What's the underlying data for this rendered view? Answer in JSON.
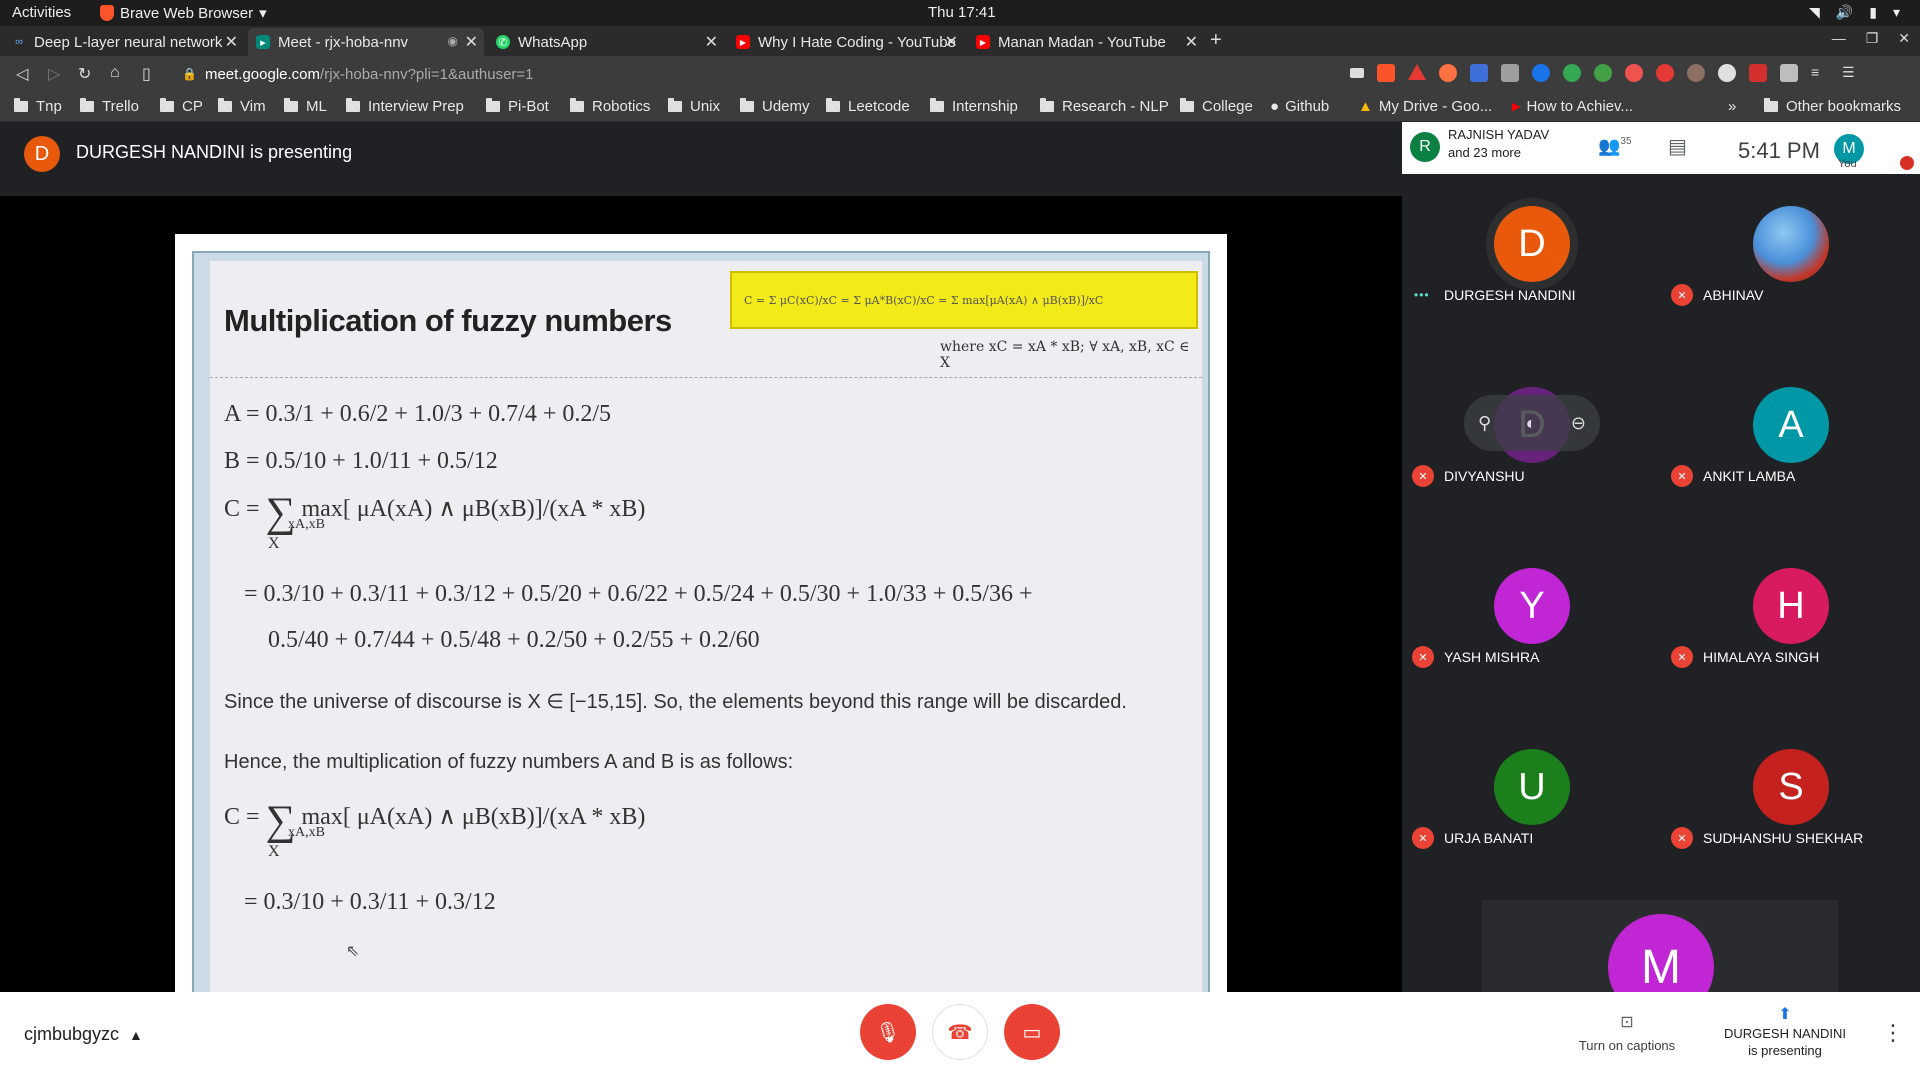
{
  "topbar": {
    "activities": "Activities",
    "app_name": "Brave Web Browser",
    "clock": "Thu 17:41"
  },
  "tabs": [
    {
      "title": "Deep L-layer neural network",
      "icon": "coursera-icon",
      "active": false
    },
    {
      "title": "Meet - rjx-hoba-nnv",
      "icon": "meet-icon",
      "active": true
    },
    {
      "title": "WhatsApp",
      "icon": "whatsapp-icon",
      "active": false
    },
    {
      "title": "Why I Hate Coding - YouTube",
      "icon": "youtube-icon",
      "active": false
    },
    {
      "title": "Manan Madan - YouTube",
      "icon": "youtube-icon",
      "active": false
    }
  ],
  "url": {
    "host": "meet.google.com",
    "path": "/rjx-hoba-nnv?pli=1&authuser=1"
  },
  "bookmarks": [
    "Tnp",
    "Trello",
    "CP",
    "Vim",
    "ML",
    "Interview Prep",
    "Pi-Bot",
    "Robotics",
    "Unix",
    "Udemy",
    "Leetcode",
    "Internship",
    "Research - NLP",
    "College",
    "Github",
    "My Drive - Goo...",
    "How to Achiev...",
    "Other bookmarks"
  ],
  "meet": {
    "presenter_initial": "D",
    "presenting_text": "DURGESH NANDINI is presenting",
    "header": {
      "first_initial": "R",
      "first_name": "RAJNISH YADAV",
      "and_more": "and 23 more",
      "people_count": "35",
      "time": "5:41 PM",
      "you_initial": "M",
      "you_label": "You"
    },
    "participants": [
      {
        "initial": "D",
        "name": "DURGESH NANDINI",
        "color": "#e8590c",
        "muted": false
      },
      {
        "initial": "",
        "name": "ABHINAV",
        "color": "#4a90d9",
        "muted": true
      },
      {
        "initial": "D",
        "name": "DIVYANSHU",
        "color": "#8e24aa",
        "muted": true
      },
      {
        "initial": "A",
        "name": "ANKIT LAMBA",
        "color": "#0097a7",
        "muted": true
      },
      {
        "initial": "Y",
        "name": "YASH MISHRA",
        "color": "#c026d3",
        "muted": true
      },
      {
        "initial": "H",
        "name": "HIMALAYA SINGH",
        "color": "#d81b60",
        "muted": true
      },
      {
        "initial": "U",
        "name": "URJA BANATI",
        "color": "#1b7f1b",
        "muted": true
      },
      {
        "initial": "S",
        "name": "SUDHANSHU SHEKHAR",
        "color": "#c5221f",
        "muted": true
      }
    ],
    "partial_tile_initial": "M",
    "meeting_code": "cjmbubgyzc",
    "captions_label": "Turn on captions",
    "present_status_line1": "DURGESH NANDINI",
    "present_status_line2": "is presenting"
  },
  "slide": {
    "title": "Multiplication of fuzzy numbers",
    "formula_box": "C = Σ μC(xC)/xC = Σ μA*B(xC)/xC = Σ max[μA(xA) ∧ μB(xB)]/xC",
    "formula_where": "where xC = xA * xB; ∀ xA, xB, xC ∈ X",
    "line_a": "A =  0.3/1  +  0.6/2  +  1.0/3  +  0.7/4  +  0.2/5",
    "line_b": "B  =  0.5/10  +  1.0/11  +  0.5/12",
    "line_c1": "max[ μA(xA)  ∧  μB(xB)]/(xA * xB)",
    "line_c1_sub": "xA,xB",
    "result1_l1": "= 0.3/10  +  0.3/11  +  0.3/12  +  0.5/20  +  0.6/22  +  0.5/24  +  0.5/30  +  1.0/33  + 0.5/36  +",
    "result1_l2": "0.5/40  +  0.7/44  +  0.5/48  +  0.2/50  +  0.2/55  +  0.2/60",
    "universe_text": "Since the universe of discourse is X  ∈ [−15,15]. So, the elements beyond this range will be discarded.",
    "hence_text": "Hence, the multiplication of fuzzy numbers A and B is as follows:",
    "line_c2": "max[ μA(xA)  ∧  μB(xB)]/(xA * xB)",
    "result2": "= 0.3/10  +  0.3/11  +  0.3/12",
    "c_prefix": "C =",
    "sigma": "∑",
    "sigma_sub": "X"
  }
}
